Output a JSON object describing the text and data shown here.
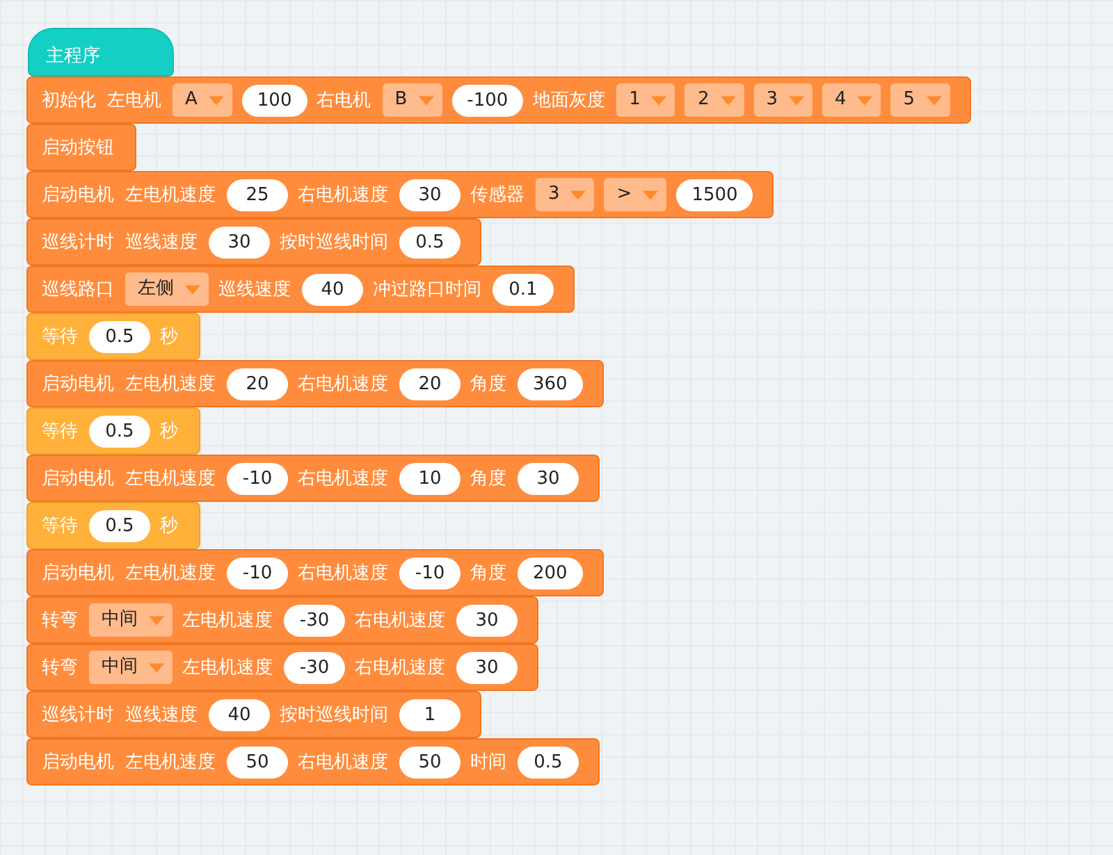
{
  "hat": {
    "label": "主程序"
  },
  "blocks": [
    {
      "kind": "action",
      "parts": [
        {
          "kind": "label",
          "text": "初始化"
        },
        {
          "kind": "label",
          "text": "左电机"
        },
        {
          "kind": "dropdown",
          "text": "A"
        },
        {
          "kind": "input",
          "text": "100"
        },
        {
          "kind": "label",
          "text": "右电机"
        },
        {
          "kind": "dropdown",
          "text": "B"
        },
        {
          "kind": "input",
          "text": "-100"
        },
        {
          "kind": "label",
          "text": "地面灰度"
        },
        {
          "kind": "dropdown",
          "text": "1"
        },
        {
          "kind": "dropdown",
          "text": "2"
        },
        {
          "kind": "dropdown",
          "text": "3"
        },
        {
          "kind": "dropdown",
          "text": "4"
        },
        {
          "kind": "dropdown",
          "text": "5"
        }
      ]
    },
    {
      "kind": "action",
      "parts": [
        {
          "kind": "label",
          "text": "启动按钮"
        }
      ]
    },
    {
      "kind": "action",
      "parts": [
        {
          "kind": "label",
          "text": "启动电机"
        },
        {
          "kind": "label",
          "text": "左电机速度"
        },
        {
          "kind": "input",
          "text": "25"
        },
        {
          "kind": "label",
          "text": "右电机速度"
        },
        {
          "kind": "input",
          "text": "30"
        },
        {
          "kind": "label",
          "text": "传感器"
        },
        {
          "kind": "dropdown",
          "text": "3"
        },
        {
          "kind": "dropdown",
          "text": ">"
        },
        {
          "kind": "input",
          "text": "1500"
        }
      ]
    },
    {
      "kind": "action",
      "parts": [
        {
          "kind": "label",
          "text": "巡线计时"
        },
        {
          "kind": "label",
          "text": "巡线速度"
        },
        {
          "kind": "input",
          "text": "30"
        },
        {
          "kind": "label",
          "text": "按时巡线时间"
        },
        {
          "kind": "input",
          "text": "0.5"
        }
      ]
    },
    {
      "kind": "action",
      "parts": [
        {
          "kind": "label",
          "text": "巡线路口"
        },
        {
          "kind": "dropdown",
          "text": "左侧"
        },
        {
          "kind": "label",
          "text": "巡线速度"
        },
        {
          "kind": "input",
          "text": "40"
        },
        {
          "kind": "label",
          "text": "冲过路口时间"
        },
        {
          "kind": "input",
          "text": "0.1"
        }
      ]
    },
    {
      "kind": "wait",
      "parts": [
        {
          "kind": "label",
          "text": "等待"
        },
        {
          "kind": "input",
          "text": "0.5"
        },
        {
          "kind": "label",
          "text": "秒"
        }
      ]
    },
    {
      "kind": "action",
      "parts": [
        {
          "kind": "label",
          "text": "启动电机"
        },
        {
          "kind": "label",
          "text": "左电机速度"
        },
        {
          "kind": "input",
          "text": "20"
        },
        {
          "kind": "label",
          "text": "右电机速度"
        },
        {
          "kind": "input",
          "text": "20"
        },
        {
          "kind": "label",
          "text": "角度"
        },
        {
          "kind": "input",
          "text": "360"
        }
      ]
    },
    {
      "kind": "wait",
      "parts": [
        {
          "kind": "label",
          "text": "等待"
        },
        {
          "kind": "input",
          "text": "0.5"
        },
        {
          "kind": "label",
          "text": "秒"
        }
      ]
    },
    {
      "kind": "action",
      "parts": [
        {
          "kind": "label",
          "text": "启动电机"
        },
        {
          "kind": "label",
          "text": "左电机速度"
        },
        {
          "kind": "input",
          "text": "-10"
        },
        {
          "kind": "label",
          "text": "右电机速度"
        },
        {
          "kind": "input",
          "text": "10"
        },
        {
          "kind": "label",
          "text": "角度"
        },
        {
          "kind": "input",
          "text": "30"
        }
      ]
    },
    {
      "kind": "wait",
      "parts": [
        {
          "kind": "label",
          "text": "等待"
        },
        {
          "kind": "input",
          "text": "0.5"
        },
        {
          "kind": "label",
          "text": "秒"
        }
      ]
    },
    {
      "kind": "action",
      "parts": [
        {
          "kind": "label",
          "text": "启动电机"
        },
        {
          "kind": "label",
          "text": "左电机速度"
        },
        {
          "kind": "input",
          "text": "-10"
        },
        {
          "kind": "label",
          "text": "右电机速度"
        },
        {
          "kind": "input",
          "text": "-10"
        },
        {
          "kind": "label",
          "text": "角度"
        },
        {
          "kind": "input",
          "text": "200"
        }
      ]
    },
    {
      "kind": "action",
      "parts": [
        {
          "kind": "label",
          "text": "转弯"
        },
        {
          "kind": "dropdown",
          "text": "中间"
        },
        {
          "kind": "label",
          "text": "左电机速度"
        },
        {
          "kind": "input",
          "text": "-30"
        },
        {
          "kind": "label",
          "text": "右电机速度"
        },
        {
          "kind": "input",
          "text": "30"
        }
      ]
    },
    {
      "kind": "action",
      "parts": [
        {
          "kind": "label",
          "text": "转弯"
        },
        {
          "kind": "dropdown",
          "text": "中间"
        },
        {
          "kind": "label",
          "text": "左电机速度"
        },
        {
          "kind": "input",
          "text": "-30"
        },
        {
          "kind": "label",
          "text": "右电机速度"
        },
        {
          "kind": "input",
          "text": "30"
        }
      ]
    },
    {
      "kind": "action",
      "parts": [
        {
          "kind": "label",
          "text": "巡线计时"
        },
        {
          "kind": "label",
          "text": "巡线速度"
        },
        {
          "kind": "input",
          "text": "40"
        },
        {
          "kind": "label",
          "text": "按时巡线时间"
        },
        {
          "kind": "input",
          "text": "1"
        }
      ]
    },
    {
      "kind": "action",
      "parts": [
        {
          "kind": "label",
          "text": "启动电机"
        },
        {
          "kind": "label",
          "text": "左电机速度"
        },
        {
          "kind": "input",
          "text": "50"
        },
        {
          "kind": "label",
          "text": "右电机速度"
        },
        {
          "kind": "input",
          "text": "50"
        },
        {
          "kind": "label",
          "text": "时间"
        },
        {
          "kind": "input",
          "text": "0.5"
        }
      ]
    }
  ]
}
